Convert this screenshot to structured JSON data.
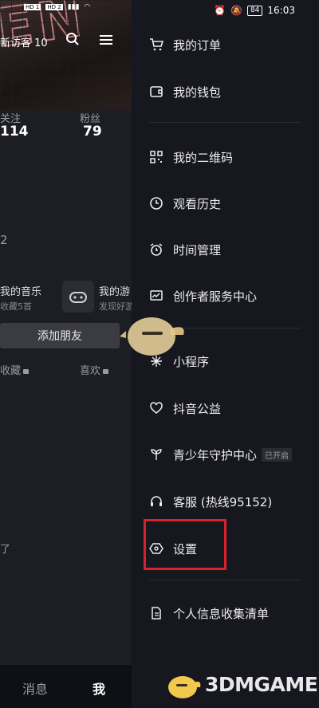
{
  "status_bar": {
    "left_badges": [
      "HD 1",
      "HD 2"
    ],
    "battery": "84",
    "time": "16:03"
  },
  "left_panel": {
    "banner_neon_text": "EN",
    "visitor_label": "新访客 10",
    "stats": [
      {
        "label": "关注",
        "value": "114"
      },
      {
        "label": "粉丝",
        "value": "79"
      }
    ],
    "section_number": "2",
    "music": {
      "title": "我的音乐",
      "subtitle": "收藏5首"
    },
    "game": {
      "title": "我的游",
      "subtitle": "发现好游"
    },
    "add_friend": "添加朋友",
    "tabs": {
      "favorites": "收藏",
      "likes": "喜欢"
    },
    "tail_text": "了",
    "bottom_nav": {
      "messages": "消息",
      "me": "我"
    }
  },
  "drawer": {
    "groups": [
      [
        {
          "label": "我的订单",
          "icon": "cart-icon"
        },
        {
          "label": "我的钱包",
          "icon": "wallet-icon"
        }
      ],
      [
        {
          "label": "我的二维码",
          "icon": "qrcode-icon"
        },
        {
          "label": "观看历史",
          "icon": "clock-icon"
        },
        {
          "label": "时间管理",
          "icon": "alarm-icon"
        },
        {
          "label": "创作者服务中心",
          "icon": "chart-icon"
        }
      ],
      [
        {
          "label": "小程序",
          "icon": "sparkle-icon"
        },
        {
          "label": "抖音公益",
          "icon": "heart-icon"
        },
        {
          "label": "青少年守护中心",
          "icon": "sprout-icon",
          "badge": "已开启"
        },
        {
          "label": "客服 (热线95152)",
          "icon": "headset-icon"
        },
        {
          "label": "设置",
          "icon": "hexagon-settings-icon"
        }
      ],
      [
        {
          "label": "个人信息收集清单",
          "icon": "document-icon"
        }
      ]
    ]
  },
  "watermark": {
    "text": "3DMGAME"
  },
  "colors": {
    "drawer_bg": "#16171f",
    "highlight": "#d6222c",
    "text": "#eeeef0"
  }
}
